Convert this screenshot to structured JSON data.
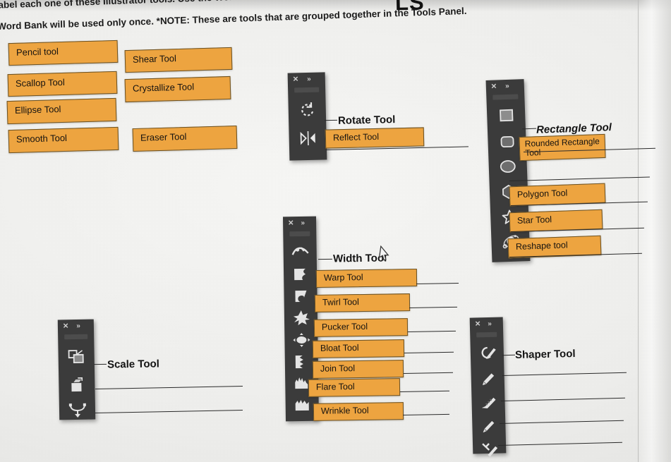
{
  "header": {
    "title_cut": "LS",
    "instruction_line1": "...abel each one of these Illustrator tools. Use the Word Bank below to help you with the correct terms and spelling. Each term in the",
    "instruction_line2": "Word Bank will be used only once. *NOTE: These are tools that are grouped together in the Tools Panel."
  },
  "colors": {
    "chip_fill": "#eda440",
    "chip_border": "#6a5226",
    "panel_fill": "#3b3b3b",
    "page_bg": "#eeeeec",
    "ink": "#141414"
  },
  "word_bank": {
    "items": [
      {
        "label": "Pencil tool"
      },
      {
        "label": "Shear Tool"
      },
      {
        "label": "Scallop Tool"
      },
      {
        "label": "Crystallize Tool"
      },
      {
        "label": "Ellipse Tool"
      },
      {
        "label": "Smooth Tool"
      },
      {
        "label": "Eraser Tool"
      }
    ]
  },
  "panels": {
    "rotate": {
      "name": "rotate-panel",
      "close_label": "✕",
      "expand_label": "»",
      "icons": [
        "rotate-icon",
        "reflect-icon"
      ],
      "answers": [
        {
          "label": "Rotate Tool",
          "filled": false
        },
        {
          "label": "Reflect Tool",
          "filled": true
        }
      ]
    },
    "shapes": {
      "name": "shapes-panel",
      "close_label": "✕",
      "expand_label": "»",
      "icons": [
        "rectangle-icon",
        "rounded-rectangle-icon",
        "ellipse-icon",
        "polygon-icon",
        "star-icon",
        "flare-icon"
      ],
      "answers": [
        {
          "label": "Rectangle Tool",
          "filled": false
        },
        {
          "label": "Rounded Rectangle Tool",
          "filled": true
        },
        {
          "label": "",
          "filled": false
        },
        {
          "label": "Polygon Tool",
          "filled": true
        },
        {
          "label": "Star Tool",
          "filled": true
        },
        {
          "label": "Reshape tool",
          "filled": true
        }
      ]
    },
    "width": {
      "name": "width-panel",
      "close_label": "✕",
      "expand_label": "»",
      "icons": [
        "width-icon",
        "warp-icon",
        "twirl-icon",
        "pucker-icon",
        "bloat-icon",
        "scallop-icon",
        "crystallize-icon",
        "wrinkle-icon"
      ],
      "answers": [
        {
          "label": "Width Tool",
          "filled": false
        },
        {
          "label": "Warp Tool",
          "filled": true
        },
        {
          "label": "Twirl Tool",
          "filled": true
        },
        {
          "label": "Pucker Tool",
          "filled": true
        },
        {
          "label": "Bloat Tool",
          "filled": true
        },
        {
          "label": "Join Tool",
          "filled": true
        },
        {
          "label": "Flare Tool",
          "filled": true
        },
        {
          "label": "Wrinkle Tool",
          "filled": true
        }
      ]
    },
    "scale": {
      "name": "scale-panel",
      "close_label": "✕",
      "expand_label": "»",
      "icons": [
        "scale-icon",
        "shear-icon",
        "reshape-icon"
      ],
      "answers": [
        {
          "label": "Scale Tool",
          "filled": false
        },
        {
          "label": "",
          "filled": false
        },
        {
          "label": "",
          "filled": false
        }
      ]
    },
    "shaper": {
      "name": "shaper-panel",
      "close_label": "✕",
      "expand_label": "»",
      "icons": [
        "shaper-icon",
        "pencil-icon",
        "smooth-icon",
        "path-eraser-icon",
        "join-icon"
      ],
      "answers": [
        {
          "label": "Shaper Tool",
          "filled": false
        },
        {
          "label": "",
          "filled": false
        },
        {
          "label": "",
          "filled": false
        },
        {
          "label": "",
          "filled": false
        },
        {
          "label": "",
          "filled": false
        }
      ]
    }
  },
  "cursor": {
    "name": "mouse-pointer"
  }
}
